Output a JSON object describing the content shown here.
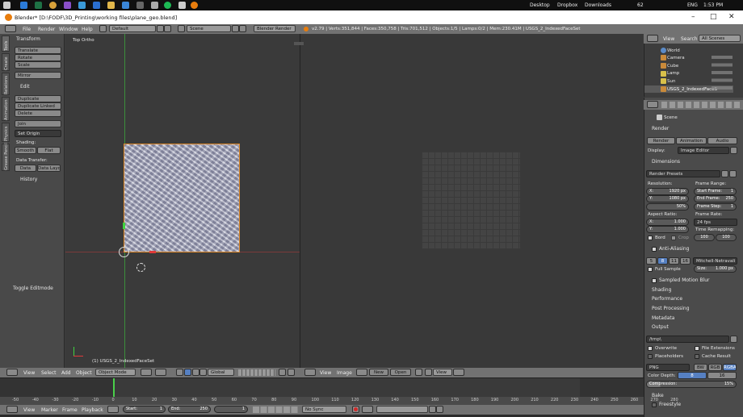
{
  "taskbar": {
    "desktop_label": "Desktop",
    "dropbox_label": "Dropbox",
    "downloads_label": "Downloads",
    "battery": "62",
    "lang": "ENG",
    "clock": "1:53 PM"
  },
  "window": {
    "title": "Blender* [D:\\FODF\\3D_Printing\\working files\\plane_geo.blend]",
    "minimize": "–",
    "maximize": "□",
    "close": "✕"
  },
  "info_header": {
    "menus": [
      "File",
      "Render",
      "Window",
      "Help"
    ],
    "layout": "Default",
    "scene": "Scene",
    "engine": "Blender Render",
    "stats": "v2.79 | Verts:351,844 | Faces:350,758 | Tris:701,512 | Objects:1/5 | Lamps:0/2 | Mem:230.41M | USGS_2_IndexedFaceSet"
  },
  "tool_tabs": [
    "Tools",
    "Create",
    "Relations",
    "Animation",
    "Physics",
    "Grease Pencil"
  ],
  "tool_shelf": {
    "transform_header": "Transform",
    "translate": "Translate",
    "rotate": "Rotate",
    "scale": "Scale",
    "mirror": "Mirror",
    "edit_header": "Edit",
    "duplicate": "Duplicate",
    "duplicate_linked": "Duplicate Linked",
    "delete": "Delete",
    "join": "Join",
    "set_origin": "Set Origin",
    "shading_label": "Shading:",
    "smooth": "Smooth",
    "flat": "Flat",
    "data_transfer_label": "Data Transfer:",
    "data": "Data",
    "data_layout": "Data Layo",
    "history": "History",
    "toggle_editmode": "Toggle Editmode"
  },
  "viewport": {
    "view_name": "Top Ortho",
    "object_name": "(1) USGS_2_IndexedFaceSet"
  },
  "view3d_header": {
    "view": "View",
    "select": "Select",
    "add": "Add",
    "object": "Object",
    "mode": "Object Mode",
    "orientation": "Global"
  },
  "image_header": {
    "view": "View",
    "image": "Image",
    "new": "New",
    "open": "Open",
    "view2": "View"
  },
  "outliner": {
    "view": "View",
    "search": "Search",
    "scenes": "All Scenes",
    "items": [
      "World",
      "Camera",
      "Cube",
      "Lamp",
      "Sun",
      "USGS_2_IndexedFaceS"
    ]
  },
  "properties": {
    "context": "Scene",
    "render_header": "Render",
    "render_btn": "Render",
    "animation_btn": "Animation",
    "audio_btn": "Audio",
    "display_label": "Display:",
    "display_value": "Image Editor",
    "dimensions_header": "Dimensions",
    "render_presets": "Render Presets",
    "resolution_label": "Resolution:",
    "res_x_label": "X:",
    "res_x": "1920 px",
    "res_y_label": "Y:",
    "res_y": "1080 px",
    "res_pct": "50%",
    "frame_range_label": "Frame Range:",
    "start_frame_label": "Start Frame:",
    "start_frame": "1",
    "end_frame_label": "End Frame:",
    "end_frame": "250",
    "frame_step_label": "Frame Step:",
    "frame_step": "1",
    "aspect_label": "Aspect Ratio:",
    "asp_x": "1.000",
    "asp_y": "1.000",
    "frame_rate_label": "Frame Rate:",
    "fps": "24 fps",
    "time_remap_label": "Time Remapping:",
    "remap_old": "100",
    "remap_new": "100",
    "border": "Bord",
    "crop": "Crop",
    "aa_header": "Anti-Aliasing",
    "aa_samples": [
      "5",
      "8",
      "11",
      "16"
    ],
    "aa_filter": "Mitchell-Netravali",
    "full_sample": "Full Sample",
    "aa_size": "Size:",
    "aa_size_val": "1.000 px",
    "motion_blur": "Sampled Motion Blur",
    "shading": "Shading",
    "performance": "Performance",
    "post_processing": "Post Processing",
    "metadata": "Metadata",
    "output_header": "Output",
    "output_path": "/tmp\\",
    "overwrite": "Overwrite",
    "file_ext": "File Extensions",
    "placeholders": "Placeholders",
    "cache_result": "Cache Result",
    "format": "PNG",
    "bw": "BW",
    "rgb": "RGB",
    "rgba": "RGBA",
    "color_depth": "Color Depth:",
    "depth_8": "8",
    "depth_16": "16",
    "compression": "Compression:",
    "compression_val": "15%",
    "bake": "Bake",
    "freestyle": "Freestyle"
  },
  "timeline": {
    "ticks": [
      "-50",
      "-40",
      "-30",
      "-20",
      "-10",
      "0",
      "10",
      "20",
      "30",
      "40",
      "50",
      "60",
      "70",
      "80",
      "90",
      "100",
      "110",
      "120",
      "130",
      "140",
      "150",
      "160",
      "170",
      "180",
      "190",
      "200",
      "210",
      "220",
      "230",
      "240",
      "250",
      "260",
      "270",
      "280"
    ],
    "view": "View",
    "marker": "Marker",
    "frame": "Frame",
    "playback": "Playback",
    "start": "Start:",
    "start_val": "1",
    "end": "End:",
    "end_val": "250",
    "current": "1",
    "sync": "No Sync"
  }
}
